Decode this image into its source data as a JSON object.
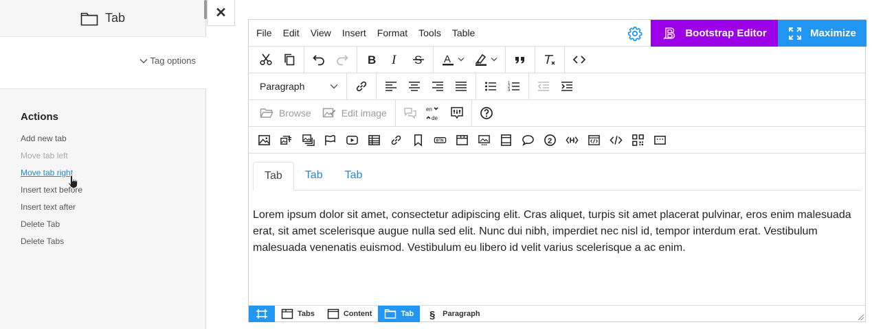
{
  "panel": {
    "title": "Tab",
    "tag_options": "Tag options",
    "actions_heading": "Actions",
    "actions": [
      {
        "label": "Add new tab",
        "state": "normal"
      },
      {
        "label": "Move tab left",
        "state": "disabled"
      },
      {
        "label": "Move tab right",
        "state": "hover"
      },
      {
        "label": "Insert text before",
        "state": "normal"
      },
      {
        "label": "Insert text after",
        "state": "normal"
      },
      {
        "label": "Delete Tab",
        "state": "normal"
      },
      {
        "label": "Delete Tabs",
        "state": "normal"
      }
    ]
  },
  "close_label": "✕",
  "menubar": {
    "items": [
      "File",
      "Edit",
      "View",
      "Insert",
      "Format",
      "Tools",
      "Table"
    ],
    "bootstrap_editor": "Bootstrap Editor",
    "maximize": "Maximize"
  },
  "toolbar": {
    "paragraph_select": "Paragraph",
    "browse": "Browse",
    "edit_image": "Edit image",
    "lang_top": "en",
    "lang_bottom": "de"
  },
  "content": {
    "tabs": [
      "Tab",
      "Tab",
      "Tab"
    ],
    "paragraph": "Lorem ipsum dolor sit amet, consectetur adipiscing elit. Cras aliquet, turpis sit amet placerat pulvinar, eros enim malesuada erat, sit amet scelerisque augue nulla sed elit. Nunc dui nibh, imperdiet nec nisl id, tempor interdum erat. Vestibulum malesuada venenatis euismod. Vestibulum eu libero id velit varius scelerisque a ac enim."
  },
  "statusbar": {
    "items": [
      "Tabs",
      "Content",
      "Tab",
      "Paragraph"
    ]
  },
  "colors": {
    "bootstrap_purple": "#9b00e8",
    "accent_blue": "#2196f3",
    "link_blue": "#1e88e5"
  }
}
